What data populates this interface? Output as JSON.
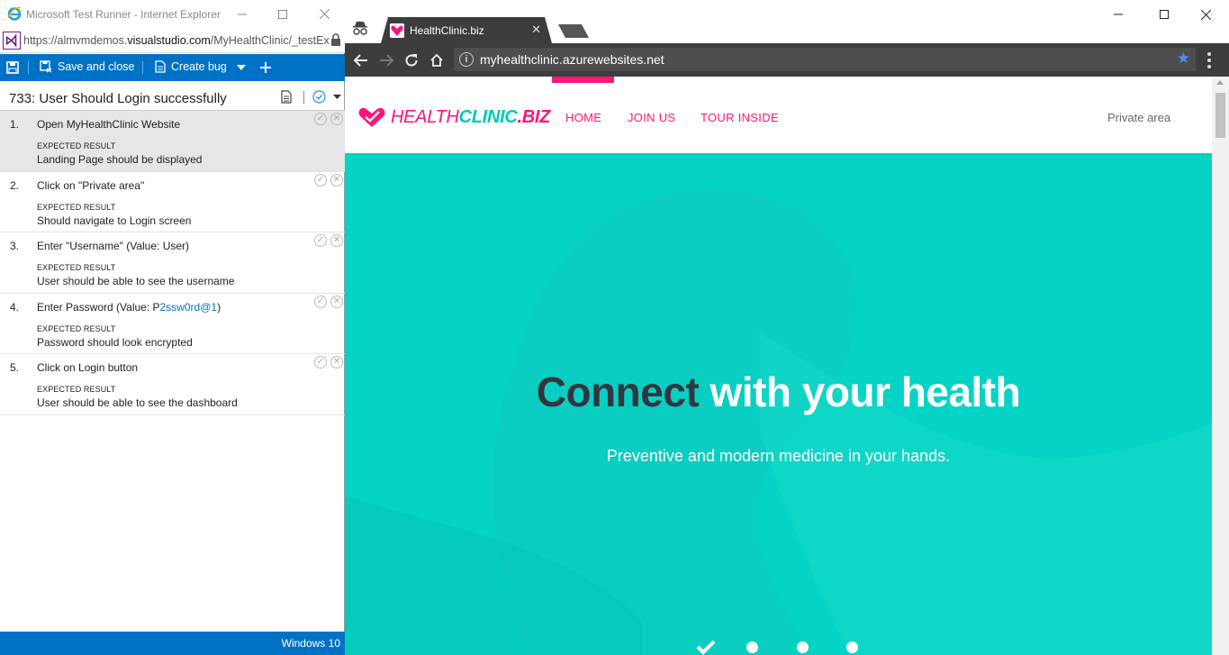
{
  "test_runner": {
    "window_title": "Microsoft Test Runner - Internet Explorer",
    "address_prefix": "https://almvmdemos.",
    "address_domain": "visualstudio.com",
    "address_path": "/MyHealthClinic/_testExe",
    "toolbar": {
      "save_and_close": "Save and close",
      "create_bug": "Create bug"
    },
    "test_case_title": "733: User Should Login successfully",
    "expected_result_label": "EXPECTED RESULT",
    "steps": [
      {
        "num": "1.",
        "action": "Open MyHealthClinic Website",
        "param": "",
        "param_close": "",
        "expected": "Landing Page should  be displayed"
      },
      {
        "num": "2.",
        "action": "Click on \"Private area\"",
        "param": "",
        "param_close": "",
        "expected": "Should navigate to Login screen"
      },
      {
        "num": "3.",
        "action": "Enter \"Username\"  (Value: User)",
        "param": "",
        "param_close": "",
        "expected": "User should be able to see the username"
      },
      {
        "num": "4.",
        "action": "Enter Password  (Value: P",
        "param": "2ssw0rd@1",
        "param_close": ")",
        "expected": "Password should look encrypted"
      },
      {
        "num": "5.",
        "action": "Click on Login button",
        "param": "",
        "param_close": "",
        "expected": "User should be able to see the dashboard"
      }
    ],
    "status_os": "Windows 10"
  },
  "browser": {
    "tab_title": "HealthClinic.biz",
    "url": "myhealthclinic.azurewebsites.net"
  },
  "site": {
    "logo_health": "HEALTH",
    "logo_clinic": "CLINIC",
    "logo_biz": ".BIZ",
    "nav": {
      "home": "HOME",
      "join_us": "JOIN US",
      "tour_inside": "TOUR INSIDE",
      "private_area": "Private area"
    },
    "hero_dark": "Connect",
    "hero_light": " with your health",
    "hero_sub": "Preventive and modern medicine in your hands."
  },
  "colors": {
    "accent_blue": "#0072c6",
    "brand_pink": "#ff1478",
    "brand_teal": "#05d3c5"
  }
}
